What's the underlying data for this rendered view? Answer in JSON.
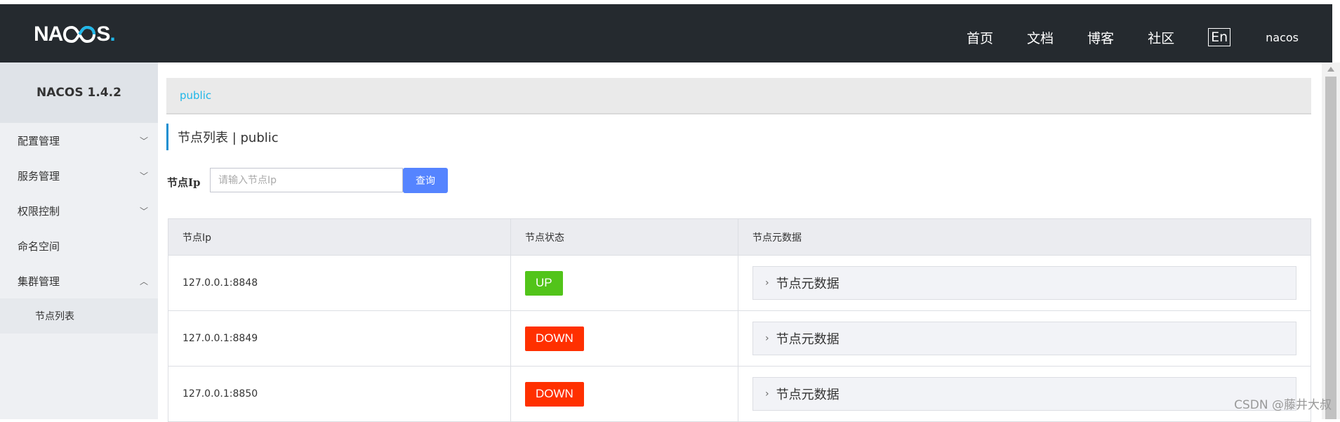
{
  "header": {
    "logo_left": "NA",
    "logo_right": "S",
    "logo_dot": ".",
    "nav": [
      "首页",
      "文档",
      "博客",
      "社区"
    ],
    "lang": "En",
    "user": "nacos"
  },
  "sidebar": {
    "version": "NACOS 1.4.2",
    "items": [
      {
        "label": "配置管理",
        "chevron": "down"
      },
      {
        "label": "服务管理",
        "chevron": "down"
      },
      {
        "label": "权限控制",
        "chevron": "down"
      },
      {
        "label": "命名空间",
        "chevron": ""
      },
      {
        "label": "集群管理",
        "chevron": "up"
      }
    ],
    "sub_items": [
      {
        "label": "节点列表"
      }
    ]
  },
  "main": {
    "breadcrumb": "public",
    "title": "节点列表 | public",
    "search": {
      "label": "节点Ip",
      "placeholder": "请输入节点Ip",
      "button": "查询"
    },
    "table": {
      "headers": [
        "节点Ip",
        "节点状态",
        "节点元数据"
      ],
      "rows": [
        {
          "ip": "127.0.0.1:8848",
          "status": "UP",
          "meta": "节点元数据"
        },
        {
          "ip": "127.0.0.1:8849",
          "status": "DOWN",
          "meta": "节点元数据"
        },
        {
          "ip": "127.0.0.1:8850",
          "status": "DOWN",
          "meta": "节点元数据"
        }
      ]
    }
  },
  "watermark": "CSDN @藤井大叔",
  "colors": {
    "header_bg": "#252a2f",
    "accent": "#1fb6e8",
    "btn": "#5584ff",
    "up": "#52c41a",
    "down": "#ff3000"
  }
}
